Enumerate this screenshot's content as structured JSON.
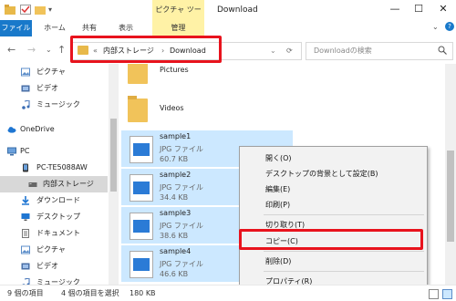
{
  "titlebar": {
    "picture_tools": "ピクチャ ツール",
    "title": "Download",
    "minimize": "—",
    "maximize": "☐",
    "close": "✕"
  },
  "ribbon": {
    "tabs": [
      "ファイル",
      "ホーム",
      "共有",
      "表示",
      "管理"
    ]
  },
  "address": {
    "chevrons": "«",
    "crumbs": [
      "内部ストレージ",
      "Download"
    ],
    "separator": "›",
    "refresh": "⟳",
    "search_placeholder": "Downloadの検索"
  },
  "sidebar": {
    "items": [
      {
        "label": "ピクチャ",
        "icon": "pictures-icon"
      },
      {
        "label": "ビデオ",
        "icon": "videos-icon"
      },
      {
        "label": "ミュージック",
        "icon": "music-icon"
      },
      {
        "label": "OneDrive",
        "icon": "onedrive-icon"
      },
      {
        "label": "PC",
        "icon": "pc-icon"
      },
      {
        "label": "PC-TE5088AW",
        "icon": "device-icon"
      },
      {
        "label": "内部ストレージ",
        "icon": "storage-icon"
      },
      {
        "label": "ダウンロード",
        "icon": "download-icon"
      },
      {
        "label": "デスクトップ",
        "icon": "desktop-icon"
      },
      {
        "label": "ドキュメント",
        "icon": "documents-icon"
      },
      {
        "label": "ピクチャ",
        "icon": "pictures-icon"
      },
      {
        "label": "ビデオ",
        "icon": "videos-icon"
      },
      {
        "label": "ミュージック",
        "icon": "music-icon"
      }
    ]
  },
  "folders": [
    {
      "name": "Pictures"
    },
    {
      "name": "Videos"
    }
  ],
  "files": [
    {
      "name": "sample1",
      "type": "JPG ファイル",
      "size": "60.7 KB"
    },
    {
      "name": "sample2",
      "type": "JPG ファイル",
      "size": "34.4 KB"
    },
    {
      "name": "sample3",
      "type": "JPG ファイル",
      "size": "38.6 KB"
    },
    {
      "name": "sample4",
      "type": "JPG ファイル",
      "size": "46.6 KB"
    }
  ],
  "context_menu": {
    "items": [
      "開く(O)",
      "デスクトップの背景として設定(B)",
      "編集(E)",
      "印刷(P)",
      "切り取り(T)",
      "コピー(C)",
      "削除(D)",
      "プロパティ(R)"
    ]
  },
  "status": {
    "count": "9 個の項目",
    "selected": "4 個の項目を選択",
    "size": "180 KB"
  },
  "colors": {
    "accent": "#1979ca",
    "selection": "#cce8ff",
    "highlight_box": "#e8131d",
    "contextual_tab": "#fff2a6"
  }
}
